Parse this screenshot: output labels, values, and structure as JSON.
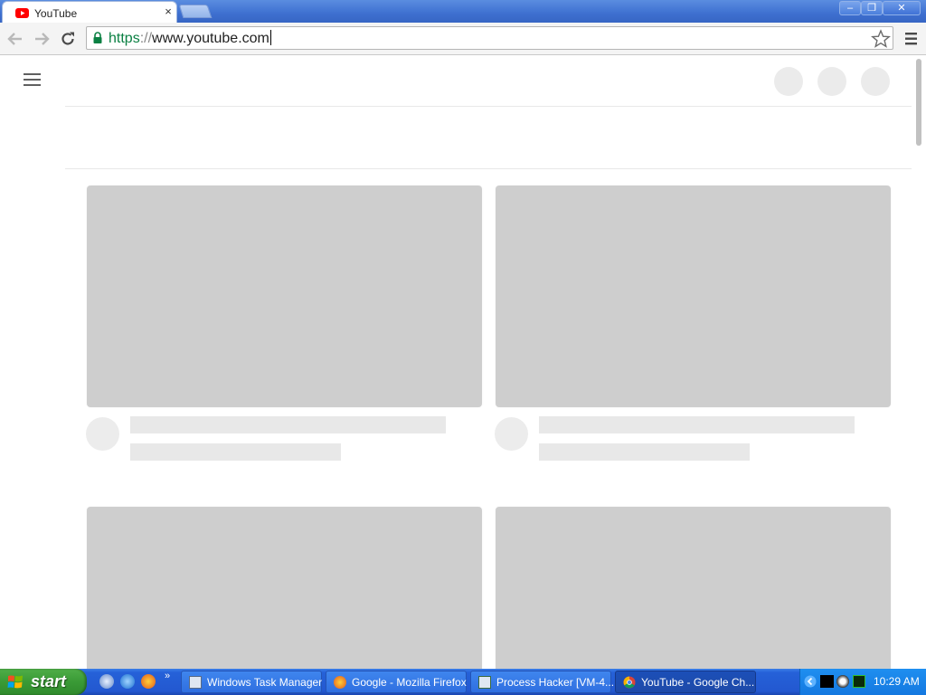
{
  "browser": {
    "tab": {
      "title": "YouTube",
      "close_glyph": "×"
    },
    "window_buttons": {
      "minimize": "‒",
      "restore": "❐",
      "close": "✕"
    },
    "address": {
      "scheme": "https",
      "separator": "://",
      "host": "www.youtube.com"
    }
  },
  "icons": {
    "tab_favicon": "youtube-icon",
    "back": "back-arrow-icon",
    "forward": "forward-arrow-icon",
    "reload": "reload-icon",
    "secure": "lock-icon",
    "bookmark": "star-icon",
    "menu": "hamburger-menu-icon"
  },
  "taskbar": {
    "start_label": "start",
    "quicklaunch_more": "»",
    "tasks": [
      {
        "label": "Windows Task Manager"
      },
      {
        "label": "Google - Mozilla Firefox"
      },
      {
        "label": "Process Hacker [VM-4..."
      },
      {
        "label": "YouTube - Google Ch..."
      }
    ],
    "clock": "10:29 AM"
  },
  "colors": {
    "youtube_red": "#ff0000",
    "secure_green": "#0b8043",
    "taskbar_blue": "#2358d0",
    "start_green": "#3a9a36",
    "skeleton_gray": "#cecece"
  }
}
